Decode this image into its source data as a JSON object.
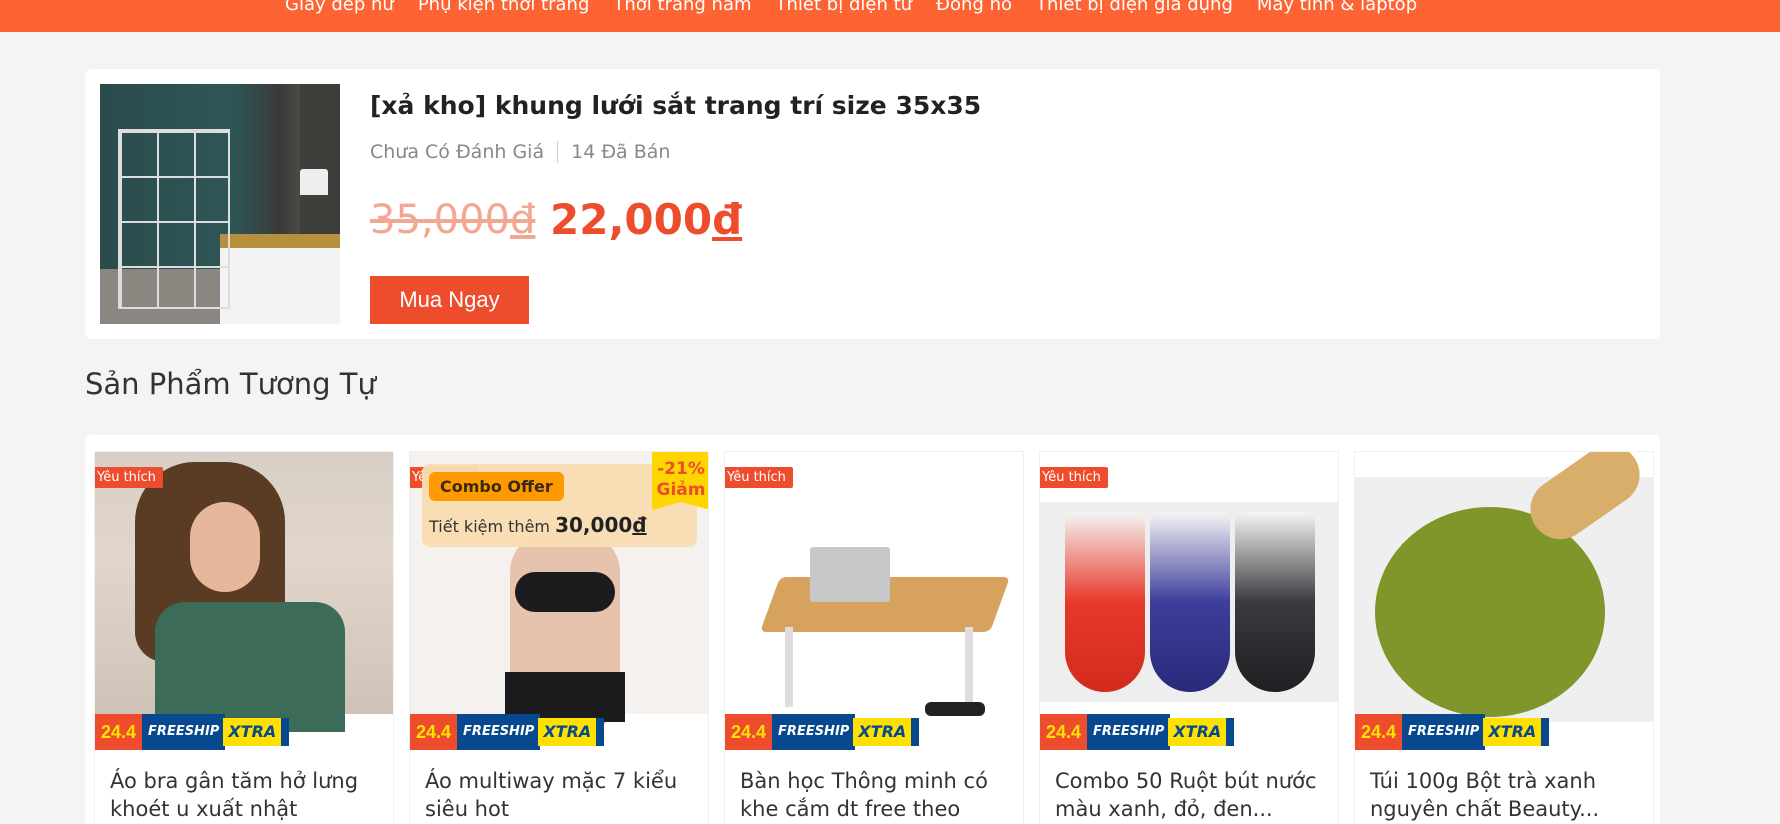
{
  "top_nav": {
    "categories": [
      "Giày dép nữ",
      "Phụ kiện thời trang",
      "Thời trang nam",
      "Thiết bị điện tử",
      "Đồng hồ",
      "Thiết bị điện gia dụng",
      "Máy tính & laptop"
    ]
  },
  "product": {
    "title": "[xả kho] khung lưới sắt trang trí size 35x35",
    "rating_text": "Chưa Có Đánh Giá",
    "sold_text": "14 Đã Bán",
    "price_old": "35,000",
    "price_new": "22,000",
    "currency": "đ",
    "buy_label": "Mua Ngay"
  },
  "similar": {
    "heading": "Sản Phẩm Tương Tự",
    "items": [
      {
        "name": "Áo bra gân tăm hở lưng khoét u xuất nhật",
        "fav": "Yêu thích"
      },
      {
        "name": "Áo multiway mặc 7 kiểu siêu hot",
        "fav": "Yêu thích",
        "combo_label": "Combo Offer",
        "save_text": "Tiết kiệm thêm",
        "save_amount": "30,000",
        "discount_pct": "-21%",
        "discount_word": "Giảm"
      },
      {
        "name": "Bàn học Thông minh có khe cắm dt free theo tiêu...",
        "fav": "Yêu thích"
      },
      {
        "name": "Combo 50 Ruột bút nước màu xanh, đỏ, đen...",
        "fav": "Yêu thích"
      },
      {
        "name": "Túi 100g Bột trà xanh nguyên chất Beauty..."
      }
    ],
    "badge": {
      "date": "24.4",
      "free": "FREESHIP",
      "xtra": "XTRA"
    }
  },
  "colors": {
    "brand": "#ee4d2d",
    "nav": "#fe6433",
    "xtra_yellow": "#ffe100",
    "xtra_blue": "#07488f"
  }
}
